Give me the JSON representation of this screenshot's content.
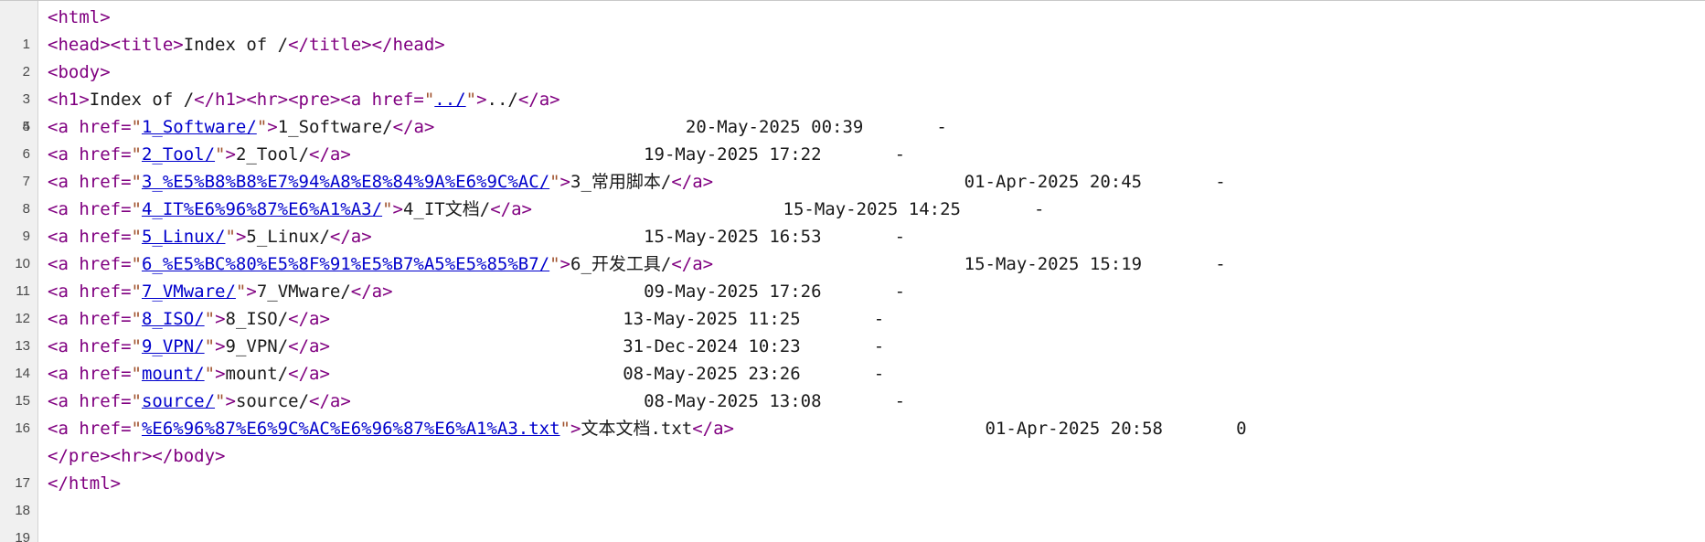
{
  "editor": {
    "line_count": 19,
    "line_numbers": [
      "1",
      "2",
      "3",
      "4",
      "5",
      "6",
      "7",
      "8",
      "9",
      "10",
      "11",
      "12",
      "13",
      "14",
      "15",
      "16",
      "17",
      "18",
      "19"
    ]
  },
  "source": {
    "line1": "<html>",
    "line2": {
      "t1": "<head><title>",
      "title_text": "Index of /",
      "t2": "</title></head>"
    },
    "line3": "<body>",
    "line4": {
      "t1": "<h1>",
      "h1_text": "Index of /",
      "t2": "</h1><hr><pre><a href=",
      "href": "../",
      "t3": ">",
      "link_text": "../",
      "t4": "</a>"
    },
    "entries": [
      {
        "href": "1_Software/",
        "name": "1_Software/",
        "pad": "                        ",
        "date": "20-May-2025 00:39",
        "gap": "       ",
        "size": "-"
      },
      {
        "href": "2_Tool/",
        "name": "2_Tool/",
        "pad": "                            ",
        "date": "19-May-2025 17:22",
        "gap": "       ",
        "size": "-"
      },
      {
        "href": "3_%E5%B8%B8%E7%94%A8%E8%84%9A%E6%9C%AC/",
        "name": "3_常用脚本/",
        "pad": "                        ",
        "date": "01-Apr-2025 20:45",
        "gap": "       ",
        "size": "-"
      },
      {
        "href": "4_IT%E6%96%87%E6%A1%A3/",
        "name": "4_IT文档/",
        "pad": "                        ",
        "date": "15-May-2025 14:25",
        "gap": "       ",
        "size": "-"
      },
      {
        "href": "5_Linux/",
        "name": "5_Linux/",
        "pad": "                          ",
        "date": "15-May-2025 16:53",
        "gap": "       ",
        "size": "-"
      },
      {
        "href": "6_%E5%BC%80%E5%8F%91%E5%B7%A5%E5%85%B7/",
        "name": "6_开发工具/",
        "pad": "                        ",
        "date": "15-May-2025 15:19",
        "gap": "       ",
        "size": "-"
      },
      {
        "href": "7_VMware/",
        "name": "7_VMware/",
        "pad": "                        ",
        "date": "09-May-2025 17:26",
        "gap": "       ",
        "size": "-"
      },
      {
        "href": "8_ISO/",
        "name": "8_ISO/",
        "pad": "                            ",
        "date": "13-May-2025 11:25",
        "gap": "       ",
        "size": "-"
      },
      {
        "href": "9_VPN/",
        "name": "9_VPN/",
        "pad": "                            ",
        "date": "31-Dec-2024 10:23",
        "gap": "       ",
        "size": "-"
      },
      {
        "href": "mount/",
        "name": "mount/",
        "pad": "                            ",
        "date": "08-May-2025 23:26",
        "gap": "       ",
        "size": "-"
      },
      {
        "href": "source/",
        "name": "source/",
        "pad": "                            ",
        "date": "08-May-2025 13:08",
        "gap": "       ",
        "size": "-"
      },
      {
        "href": "%E6%96%87%E6%9C%AC%E6%96%87%E6%A1%A3.txt",
        "name": "文本文档.txt",
        "pad": "                        ",
        "date": "01-Apr-2025 20:58",
        "gap": "       ",
        "size": "0"
      }
    ],
    "line17": "</pre><hr></body>",
    "line18": "</html>",
    "tokens": {
      "a_open": "<a href=",
      "quote": "\"",
      "close_bracket": ">",
      "a_close": "</a>"
    }
  },
  "colors": {
    "tag": "#800080",
    "attr_value": "#a0522d",
    "link": "#0000cc",
    "text": "#1a1a1a",
    "gutter_bg": "#f0f0f0"
  }
}
